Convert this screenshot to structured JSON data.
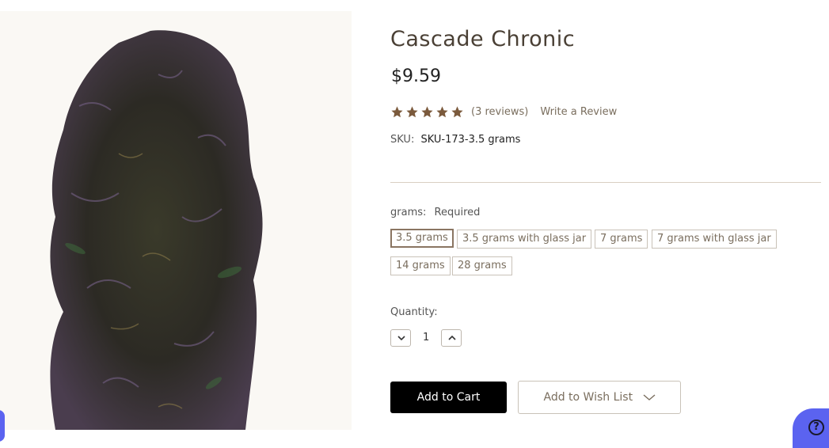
{
  "product": {
    "name": "Cascade Chronic",
    "price": "$9.59",
    "rating_stars": 5,
    "reviews_text": "(3 reviews)",
    "write_review": "Write a Review",
    "sku_label": "SKU:",
    "sku_value": "SKU-173-3.5 grams"
  },
  "options": {
    "label": "grams:",
    "required": "Required",
    "choices": [
      {
        "label": "3.5 grams",
        "selected": true
      },
      {
        "label": "3.5 grams with glass jar",
        "selected": false
      },
      {
        "label": "7 grams",
        "selected": false
      },
      {
        "label": "7 grams with glass jar",
        "selected": false
      },
      {
        "label": "14 grams",
        "selected": false
      },
      {
        "label": "28 grams",
        "selected": false
      }
    ]
  },
  "quantity": {
    "label": "Quantity:",
    "value": "1"
  },
  "actions": {
    "add_to_cart": "Add to Cart",
    "add_to_wishlist": "Add to Wish List"
  },
  "colors": {
    "accent": "#7a6e5e",
    "star": "#7b5a3c",
    "help_bubble": "#5b63f0"
  },
  "icons": {
    "star": "star-icon",
    "chevron_down": "chevron-down-icon",
    "chevron_up": "chevron-up-icon",
    "help": "help-icon"
  }
}
